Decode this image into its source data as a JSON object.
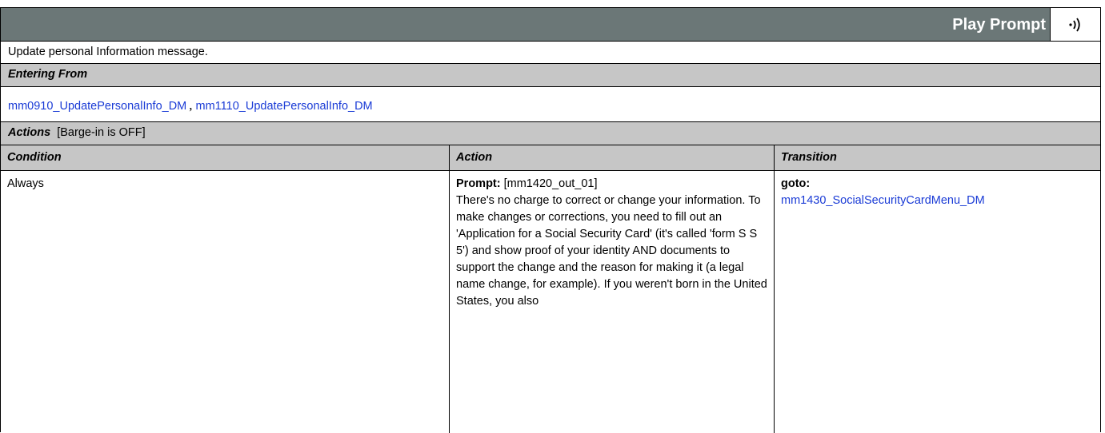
{
  "page": {
    "heading_fragment": ""
  },
  "header": {
    "play_prompt_label": "Play Prompt",
    "icon": "speaker-icon"
  },
  "description": "Update personal Information message.",
  "entering_from": {
    "label": "Entering From",
    "links": [
      "mm0910_UpdatePersonalInfo_DM",
      "mm1110_UpdatePersonalInfo_DM"
    ],
    "separator": ","
  },
  "actions": {
    "label": "Actions",
    "note": "[Barge-in is OFF]"
  },
  "columns": {
    "condition": "Condition",
    "action": "Action",
    "transition": "Transition"
  },
  "row": {
    "condition": "Always",
    "prompt_label": "Prompt:",
    "prompt_id": "[mm1420_out_01]",
    "prompt_text": "There's no charge to correct or change your information. To make changes or corrections, you need to fill out an 'Application for a Social Security Card' (it's called 'form S S 5') and show proof of your identity AND documents to support the change and the reason for making it (a legal name change, for example).  If you weren't born in the United States, you also",
    "goto_label": "goto:",
    "goto_target": "mm1430_SocialSecurityCardMenu_DM"
  },
  "colors": {
    "header_bg": "#6b7777",
    "subheader_bg": "#c6c6c6",
    "link": "#1a3bd6"
  }
}
